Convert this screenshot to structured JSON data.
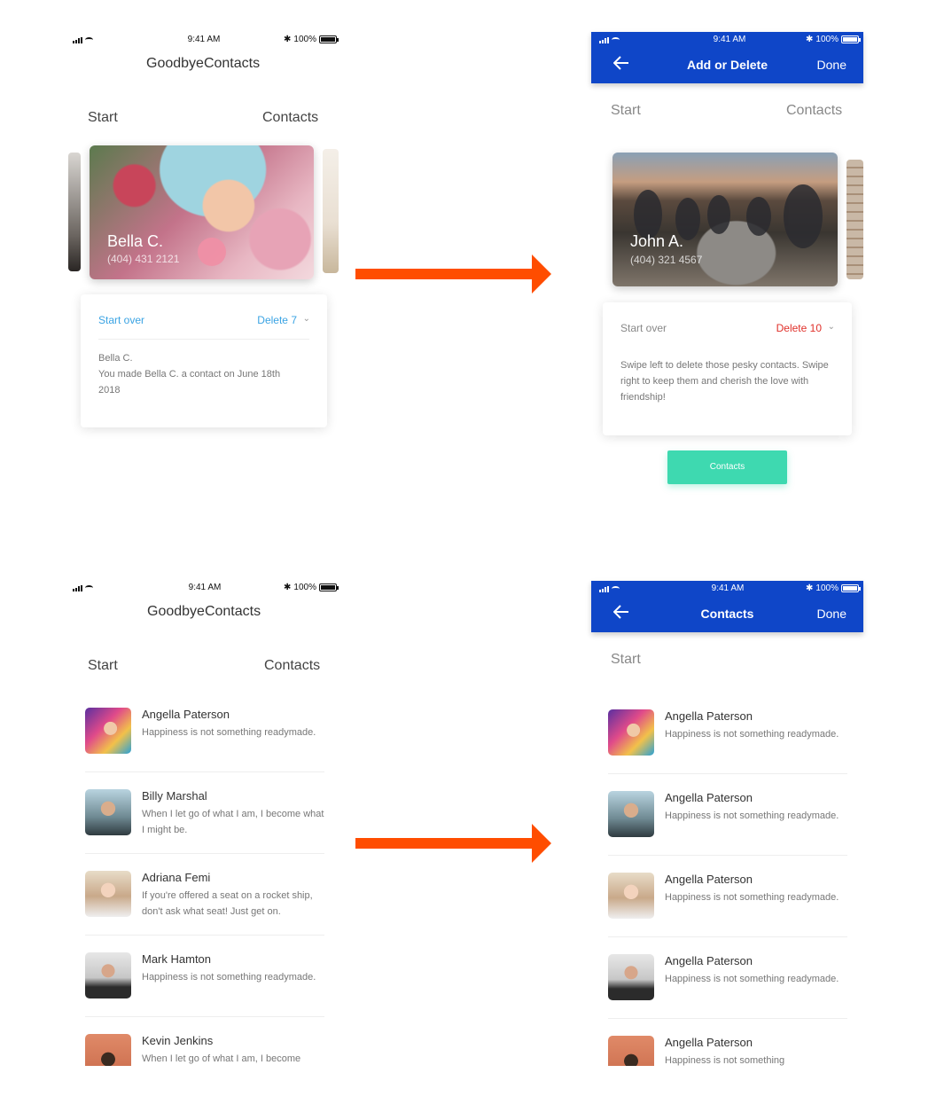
{
  "colors": {
    "header_blue": "#0f46c8",
    "arrow_orange": "#ff4d00",
    "accent_blue": "#3aa3e3",
    "delete_red": "#e0302a",
    "cta_teal": "#3ed9b0"
  },
  "status": {
    "time": "9:41 AM",
    "battery": "100%",
    "bluetooth": "✱"
  },
  "app": {
    "title": "GoodbyeContacts"
  },
  "tabs": {
    "start": "Start",
    "contacts": "Contacts"
  },
  "header_add": {
    "title": "Add or Delete",
    "done": "Done"
  },
  "header_contacts": {
    "title": "Contacts",
    "done": "Done"
  },
  "card_left": {
    "name": "Bella C.",
    "phone": "(404) 431 2121",
    "start_over": "Start over",
    "delete": "Delete 7",
    "body_name": "Bella C.",
    "body_text": "You made Bella C. a contact on June 18th 2018"
  },
  "card_right": {
    "name": "John A.",
    "phone": "(404) 321 4567",
    "start_over": "Start over",
    "delete": "Delete 10",
    "body_text": "Swipe left to delete those pesky contacts. Swipe right to keep them and cherish the love with friendship!",
    "cta": "Contacts"
  },
  "list_left": [
    {
      "name": "Angella Paterson",
      "text": "Happiness is not something readymade."
    },
    {
      "name": "Billy Marshal",
      "text": "When I let go of what I am, I become what I might be."
    },
    {
      "name": "Adriana Femi",
      "text": "If you're offered a seat on a rocket ship, don't ask what seat! Just get on."
    },
    {
      "name": "Mark Hamton",
      "text": "Happiness is not something readymade."
    },
    {
      "name": "Kevin Jenkins",
      "text": "When I let go of what I am, I become"
    }
  ],
  "list_right": [
    {
      "name": "Angella Paterson",
      "text": "Happiness is not something readymade."
    },
    {
      "name": "Angella Paterson",
      "text": "Happiness is not something readymade."
    },
    {
      "name": "Angella Paterson",
      "text": "Happiness is not something readymade."
    },
    {
      "name": "Angella Paterson",
      "text": "Happiness is not something readymade."
    },
    {
      "name": "Angella Paterson",
      "text": "Happiness is not something"
    }
  ]
}
